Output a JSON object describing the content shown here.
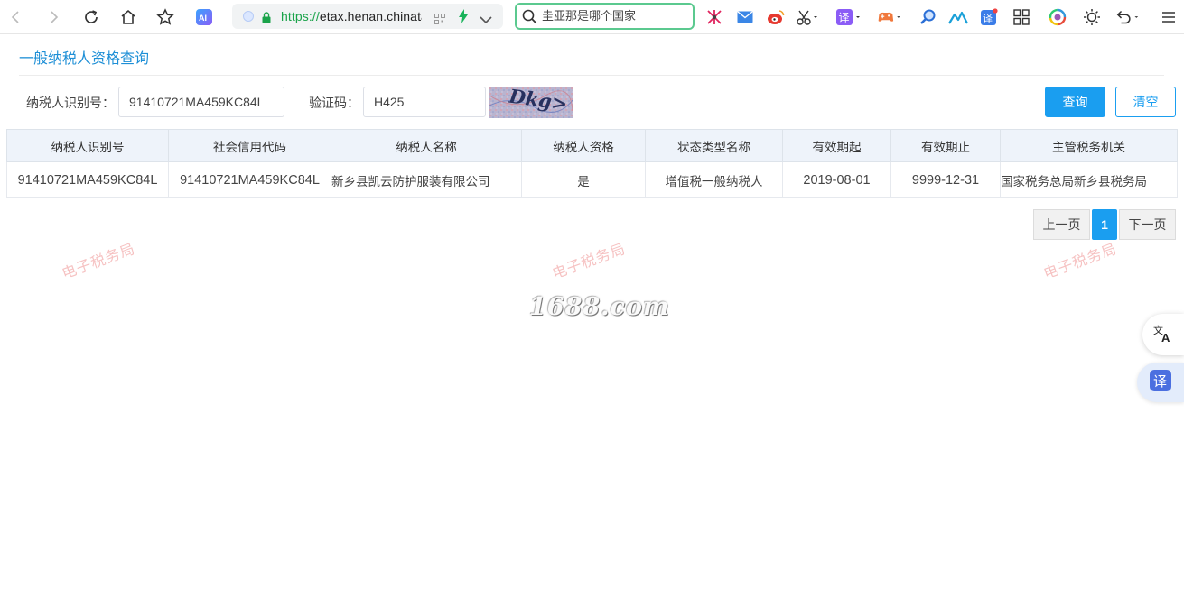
{
  "browser": {
    "url_scheme": "https://",
    "url_host": "etax.henan.chinatax.gov.cn",
    "search_placeholder": "圭亚那是哪个国家"
  },
  "page": {
    "title": "一般纳税人资格查询"
  },
  "form": {
    "taxpayer_id_label": "纳税人识别号：",
    "taxpayer_id_value": "91410721MA459KC84L",
    "captcha_label": "验证码：",
    "captcha_value": "H425",
    "captcha_image_text": "Dkg>",
    "query_button": "查询",
    "clear_button": "清空"
  },
  "table": {
    "headers": [
      "纳税人识别号",
      "社会信用代码",
      "纳税人名称",
      "纳税人资格",
      "状态类型名称",
      "有效期起",
      "有效期止",
      "主管税务机关"
    ],
    "rows": [
      [
        "91410721MA459KC84L",
        "91410721MA459KC84L",
        "新乡县凯云防护服装有限公司",
        "是",
        "增值税一般纳税人",
        "2019-08-01",
        "9999-12-31",
        "国家税务总局新乡县税务局"
      ]
    ]
  },
  "pager": {
    "prev": "上一页",
    "current": "1",
    "next": "下一页"
  },
  "watermarks": {
    "text": "电子税务局",
    "logo": "1688.com"
  },
  "colors": {
    "accent": "#1a9ef0",
    "title": "#1e8fd6",
    "header_bg": "#eef3fa"
  }
}
